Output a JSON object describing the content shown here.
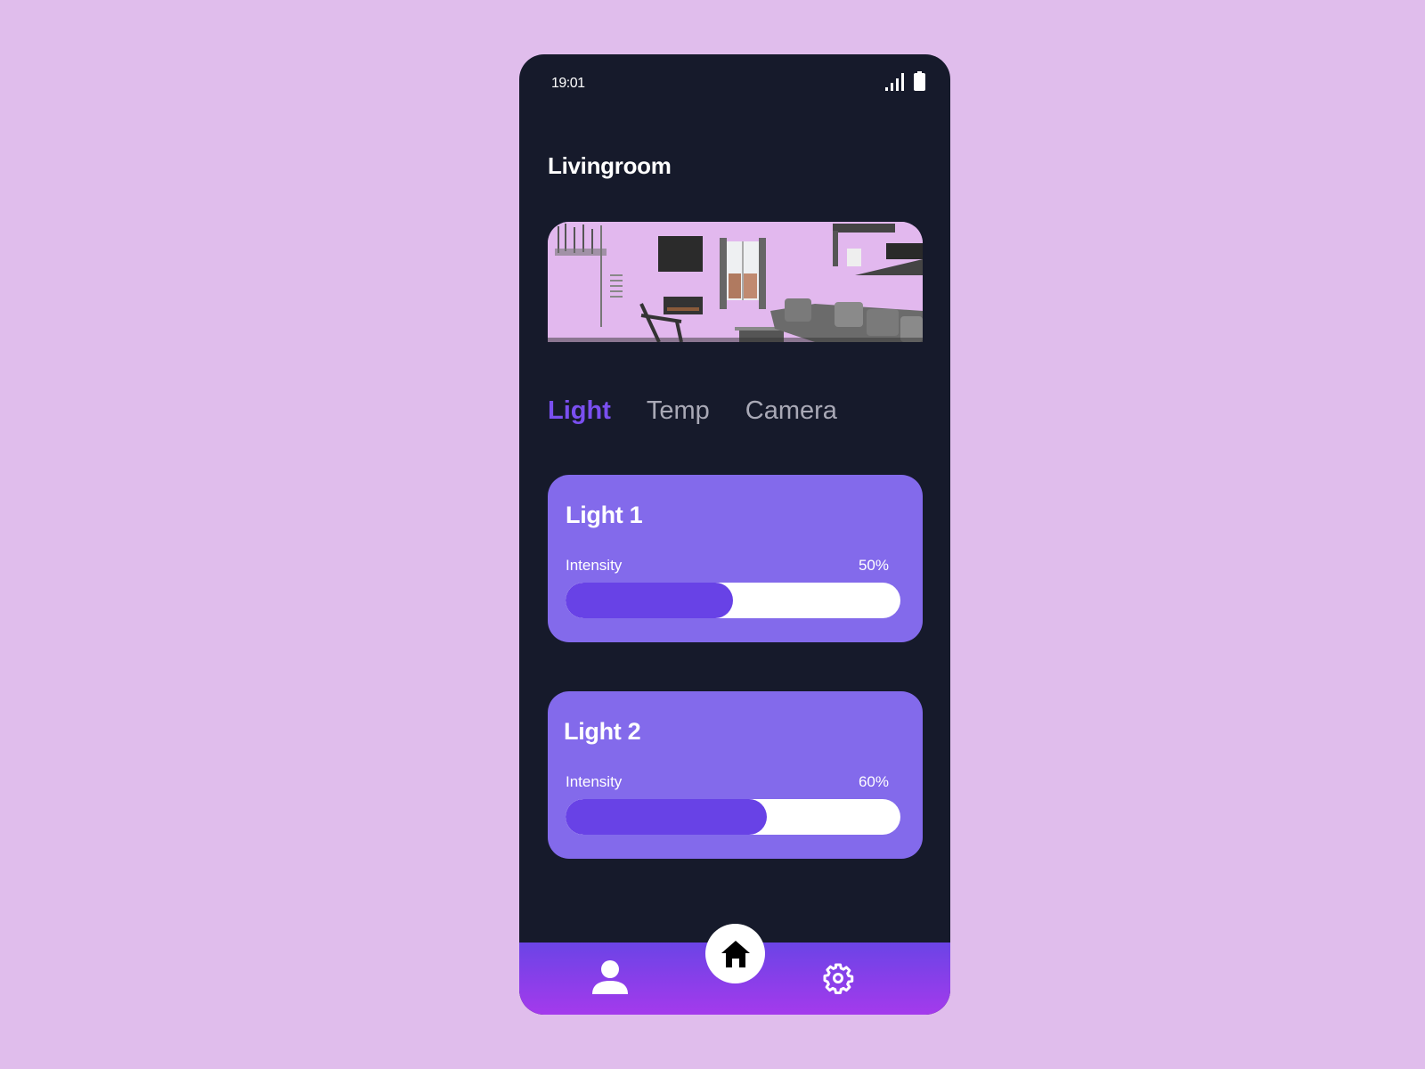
{
  "status_bar": {
    "time": "19:01",
    "signal_icon": "signal-bars-icon",
    "battery_icon": "battery-icon"
  },
  "header": {
    "title": "Livingroom"
  },
  "room_image": {
    "description": "living room camera view"
  },
  "tabs": [
    {
      "label": "Light",
      "active": true
    },
    {
      "label": "Temp",
      "active": false
    },
    {
      "label": "Camera",
      "active": false
    }
  ],
  "lights": [
    {
      "title": "Light 1",
      "intensity_label": "Intensity",
      "intensity_text": "50%",
      "intensity": 50
    },
    {
      "title": "Light 2",
      "intensity_label": "Intensity",
      "intensity_text": "60%",
      "intensity": 60
    }
  ],
  "bottom_nav": {
    "items": [
      {
        "icon": "user-icon",
        "label": "Profile"
      },
      {
        "icon": "home-icon",
        "label": "Home",
        "active": true
      },
      {
        "icon": "gear-icon",
        "label": "Settings"
      }
    ]
  },
  "colors": {
    "page_background": "#e0bdec",
    "phone_background": "#161a2b",
    "accent": "#7a4ff0",
    "card": "#836aeb",
    "slider_fill": "#6842e6",
    "nav_gradient_top": "#6b44e6",
    "nav_gradient_bottom": "#a43aec"
  }
}
